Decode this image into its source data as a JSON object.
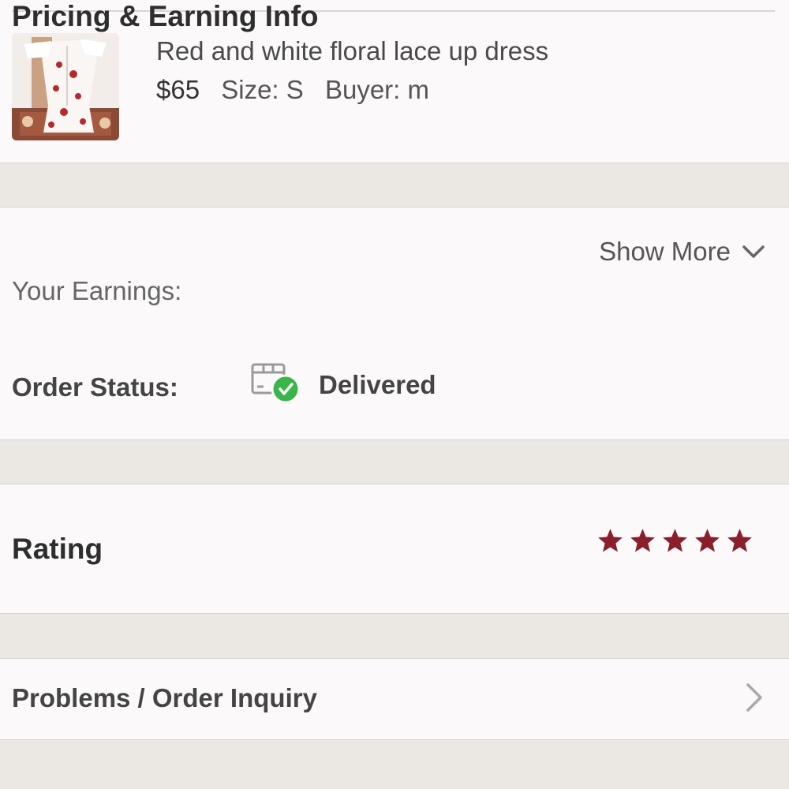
{
  "item": {
    "title": "Red and white floral lace up dress",
    "price": "$65",
    "size": "Size: S",
    "buyer": "Buyer: m"
  },
  "pricing": {
    "title": "Pricing & Earning Info",
    "earnings_label": "Your Earnings:",
    "show_more": "Show More",
    "show_more_icon": "chevron-down-icon"
  },
  "status": {
    "label": "Order Status:",
    "value": "Delivered",
    "icon": "package-delivered-icon",
    "check_color": "#3ab54a"
  },
  "rating": {
    "label": "Rating",
    "stars": 5,
    "star_color": "#8a1e2c"
  },
  "problems": {
    "label": "Problems / Order Inquiry",
    "icon": "chevron-right-icon"
  }
}
